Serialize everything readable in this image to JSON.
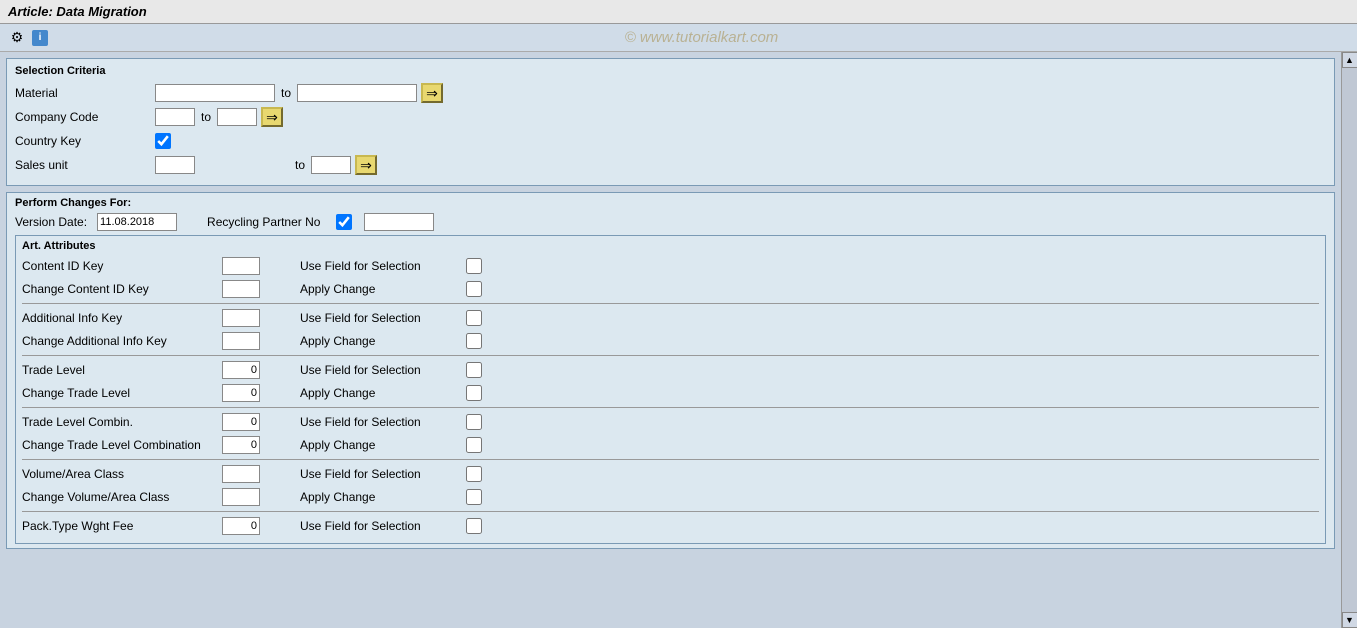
{
  "title": "Article: Data Migration",
  "watermark": "© www.tutorialkart.com",
  "toolbar": {
    "settings_icon": "⚙",
    "info_icon": "i"
  },
  "selection_criteria": {
    "title": "Selection Criteria",
    "fields": [
      {
        "label": "Material",
        "input_from": "",
        "input_to": "",
        "has_arrow": true,
        "type": "range_wide"
      },
      {
        "label": "Company Code",
        "input_from": "",
        "input_to": "",
        "has_arrow": true,
        "type": "range_narrow"
      },
      {
        "label": "Country Key",
        "checkbox": true,
        "type": "checkbox_only"
      },
      {
        "label": "Sales unit",
        "input_from": "",
        "input_to": "",
        "has_arrow": true,
        "type": "range_sales"
      }
    ],
    "to_label": "to"
  },
  "perform_changes": {
    "title": "Perform Changes For:",
    "version_date_label": "Version Date:",
    "version_date_value": "11.08.2018",
    "recycling_label": "Recycling Partner No"
  },
  "art_attributes": {
    "title": "Art. Attributes",
    "rows": [
      {
        "label": "Content ID Key",
        "input_value": "",
        "right_label": "Use Field for Selection",
        "right_checked": false,
        "separator_after": false
      },
      {
        "label": "Change Content ID Key",
        "input_value": "",
        "right_label": "Apply Change",
        "right_checked": false,
        "separator_after": true
      },
      {
        "label": "Additional Info Key",
        "input_value": "",
        "right_label": "Use Field for Selection",
        "right_checked": false,
        "separator_after": false
      },
      {
        "label": "Change Additional Info Key",
        "input_value": "",
        "right_label": "Apply Change",
        "right_checked": false,
        "separator_after": true
      },
      {
        "label": "Trade Level",
        "input_value": "0",
        "right_label": "Use Field for Selection",
        "right_checked": false,
        "separator_after": false
      },
      {
        "label": "Change Trade Level",
        "input_value": "0",
        "right_label": "Apply Change",
        "right_checked": false,
        "separator_after": true
      },
      {
        "label": "Trade Level Combin.",
        "input_value": "0",
        "right_label": "Use Field for Selection",
        "right_checked": false,
        "separator_after": false
      },
      {
        "label": "Change Trade Level Combination",
        "input_value": "0",
        "right_label": "Apply Change",
        "right_checked": false,
        "separator_after": true
      },
      {
        "label": "Volume/Area Class",
        "input_value": "",
        "right_label": "Use Field for Selection",
        "right_checked": false,
        "separator_after": false
      },
      {
        "label": "Change Volume/Area Class",
        "input_value": "",
        "right_label": "Apply Change",
        "right_checked": false,
        "separator_after": true
      },
      {
        "label": "Pack.Type Wght Fee",
        "input_value": "0",
        "right_label": "Use Field for Selection",
        "right_checked": false,
        "separator_after": false
      }
    ]
  }
}
